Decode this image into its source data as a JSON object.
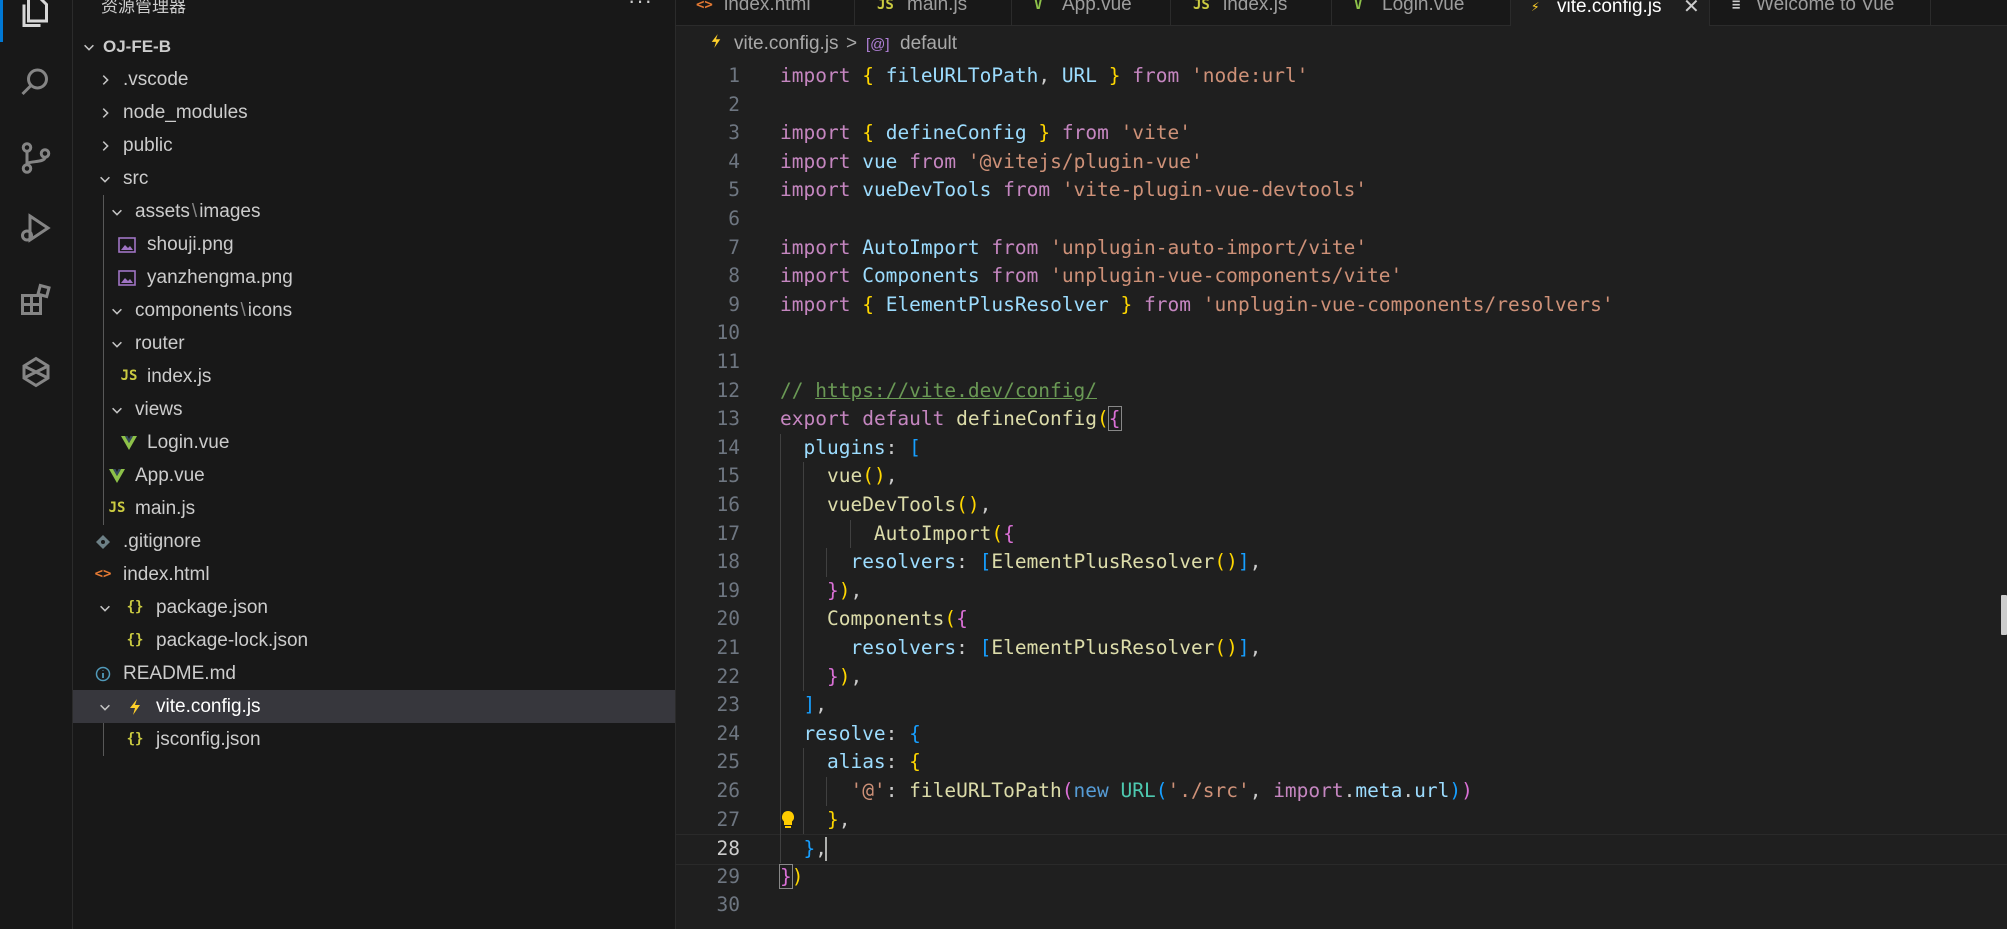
{
  "sidebar": {
    "title": "资源管理器",
    "more": "···",
    "root": "OJ-FE-B",
    "items": [
      {
        "label": ".vscode"
      },
      {
        "label": "node_modules"
      },
      {
        "label": "public"
      },
      {
        "label": "src"
      },
      {
        "label": "assets",
        "label2": "images",
        "sep": "\\"
      },
      {
        "label": "shouji.png"
      },
      {
        "label": "yanzhengma.png"
      },
      {
        "label": "components",
        "label2": "icons",
        "sep": "\\"
      },
      {
        "label": "router"
      },
      {
        "label": "index.js"
      },
      {
        "label": "views"
      },
      {
        "label": "Login.vue"
      },
      {
        "label": "App.vue"
      },
      {
        "label": "main.js"
      },
      {
        "label": ".gitignore"
      },
      {
        "label": "index.html"
      },
      {
        "label": "package.json"
      },
      {
        "label": "package-lock.json"
      },
      {
        "label": "README.md"
      },
      {
        "label": "vite.config.js"
      },
      {
        "label": "jsconfig.json"
      }
    ]
  },
  "tabs": [
    {
      "label": "index.html",
      "icon": "<>"
    },
    {
      "label": "main.js",
      "icon": "JS"
    },
    {
      "label": "App.vue",
      "icon": "V"
    },
    {
      "label": "index.js",
      "icon": "JS"
    },
    {
      "label": "Login.vue",
      "icon": "V"
    },
    {
      "label": "vite.config.js",
      "icon": "⚡",
      "close": "✕"
    },
    {
      "label": "Welcome to Vue",
      "icon": "≡"
    }
  ],
  "breadcrumb": {
    "file": "vite.config.js",
    "sep": ">",
    "symbol_icon": "[@]",
    "symbol": "default"
  },
  "editor": {
    "line_numbers": [
      "1",
      "2",
      "3",
      "4",
      "5",
      "6",
      "7",
      "8",
      "9",
      "10",
      "11",
      "12",
      "13",
      "14",
      "15",
      "16",
      "17",
      "18",
      "19",
      "20",
      "21",
      "22",
      "23",
      "24",
      "25",
      "26",
      "27",
      "28",
      "29",
      "30"
    ],
    "current_line": "28"
  },
  "icon_colors": {
    "js": "#cbcb41",
    "vue": "#8dc149",
    "html": "#e37933",
    "json": "#cbcb41",
    "image": "#a074c4",
    "info": "#519aba",
    "git": "#41535b",
    "vite": "#ffd02a"
  }
}
